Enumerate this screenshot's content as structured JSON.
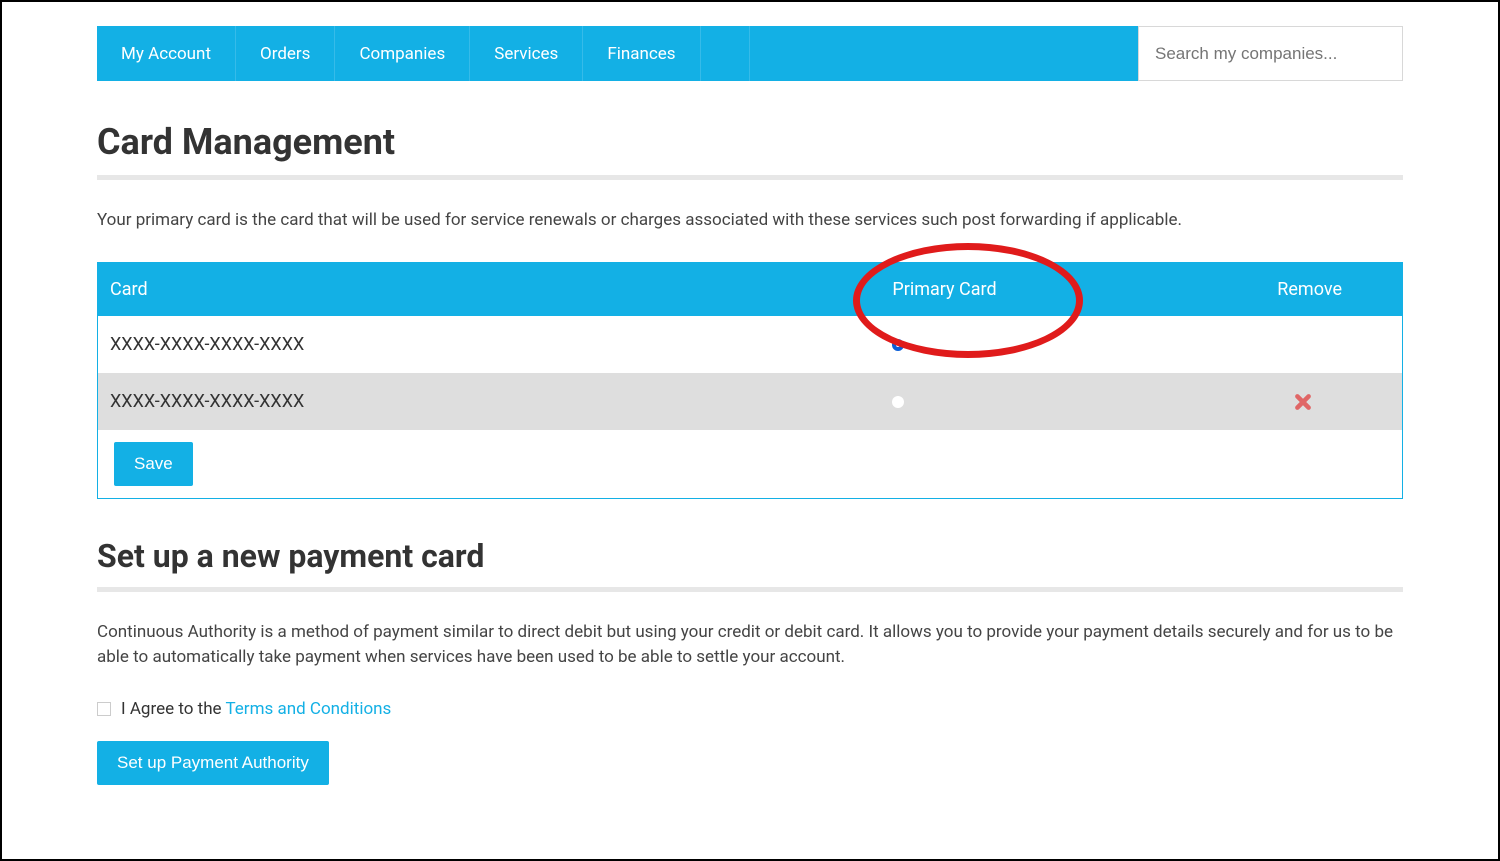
{
  "nav": {
    "items": [
      {
        "label": "My Account"
      },
      {
        "label": "Orders"
      },
      {
        "label": "Companies"
      },
      {
        "label": "Services"
      },
      {
        "label": "Finances"
      }
    ],
    "search_placeholder": "Search my companies..."
  },
  "card_management": {
    "title": "Card Management",
    "description": "Your primary card is the card that will be used for service renewals or charges associated with these services such post forwarding if applicable.",
    "headers": {
      "card": "Card",
      "primary": "Primary Card",
      "remove": "Remove"
    },
    "rows": [
      {
        "card": "XXXX-XXXX-XXXX-XXXX",
        "is_primary": true,
        "removable": false
      },
      {
        "card": "XXXX-XXXX-XXXX-XXXX",
        "is_primary": false,
        "removable": true
      }
    ],
    "save_label": "Save"
  },
  "new_card": {
    "title": "Set up a new payment card",
    "description": "Continuous Authority is a method of payment similar to direct debit but using your credit or debit card. It allows you to provide your payment details securely and for us to be able to automatically take payment when services have been used to be able to settle your account.",
    "agree_prefix": "I Agree to the ",
    "terms_link_label": "Terms and Conditions",
    "setup_button_label": "Set up Payment Authority"
  },
  "colors": {
    "accent": "#13b0e5",
    "annotation": "#e01b1b"
  }
}
